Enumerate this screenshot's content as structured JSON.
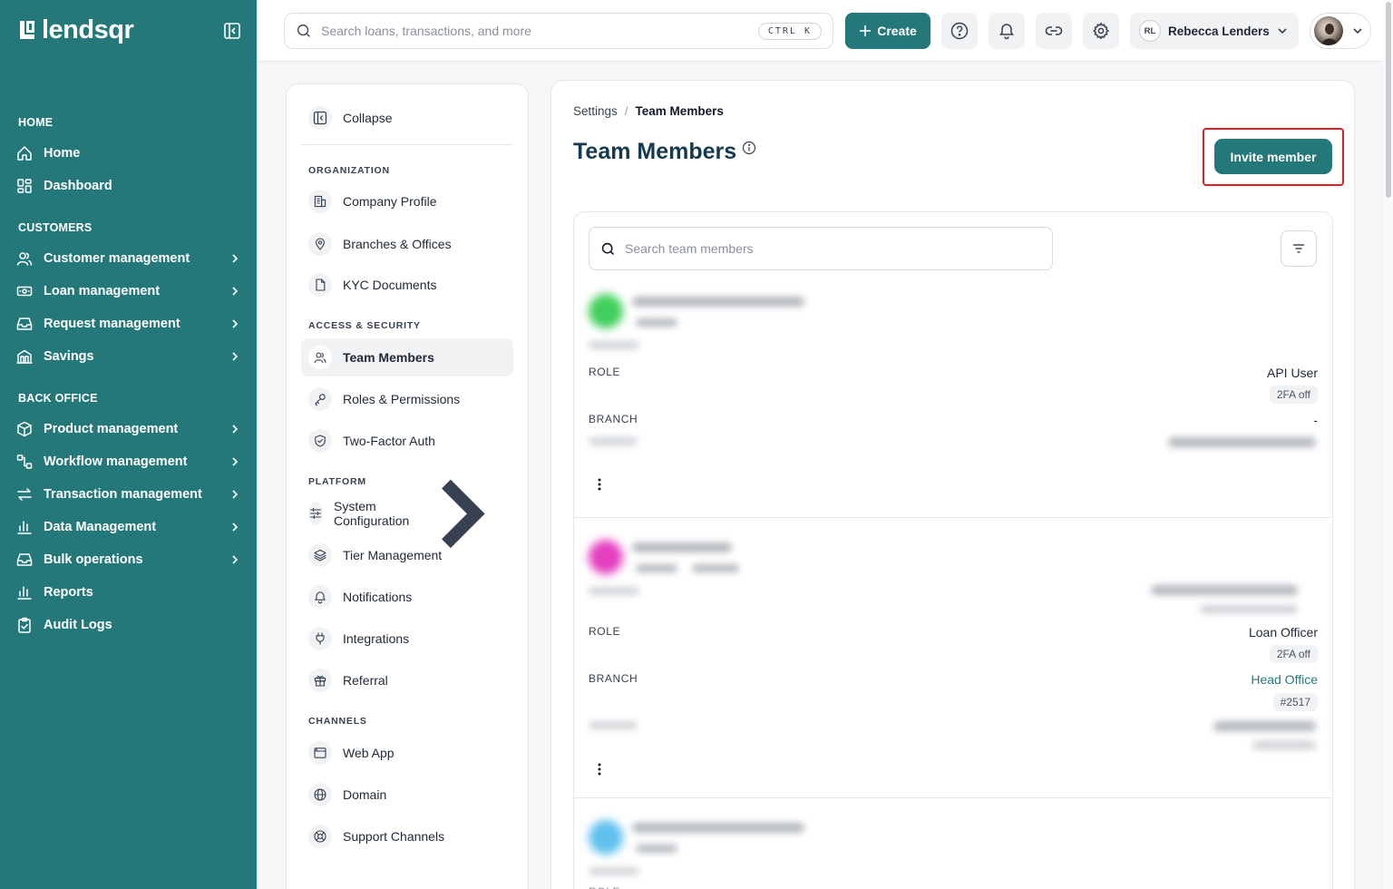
{
  "brand": {
    "name": "lendsqr"
  },
  "colors": {
    "primary": "#24787a",
    "highlight": "#e11d24",
    "title": "#143a4f"
  },
  "sidebar": {
    "sections": [
      {
        "title": "HOME",
        "items": [
          {
            "label": "Home",
            "icon": "home-icon",
            "chevron": false
          },
          {
            "label": "Dashboard",
            "icon": "dashboard-grid-icon",
            "chevron": false
          }
        ]
      },
      {
        "title": "CUSTOMERS",
        "items": [
          {
            "label": "Customer management",
            "icon": "users-icon",
            "chevron": true
          },
          {
            "label": "Loan management",
            "icon": "money-icon",
            "chevron": true
          },
          {
            "label": "Request management",
            "icon": "inbox-icon",
            "chevron": true
          },
          {
            "label": "Savings",
            "icon": "savings-icon",
            "chevron": true
          }
        ]
      },
      {
        "title": "BACK OFFICE",
        "items": [
          {
            "label": "Product management",
            "icon": "box-icon",
            "chevron": true
          },
          {
            "label": "Workflow management",
            "icon": "workflow-icon",
            "chevron": true
          },
          {
            "label": "Transaction management",
            "icon": "transfer-icon",
            "chevron": true
          },
          {
            "label": "Data Management",
            "icon": "bar-chart-icon",
            "chevron": true
          },
          {
            "label": "Bulk operations",
            "icon": "inbox-icon",
            "chevron": true
          },
          {
            "label": "Reports",
            "icon": "bar-chart-icon",
            "chevron": false
          },
          {
            "label": "Audit Logs",
            "icon": "clipboard-check-icon",
            "chevron": false
          }
        ]
      }
    ]
  },
  "topbar": {
    "search_placeholder": "Search loans, transactions, and more",
    "shortcut": "CTRL K",
    "create_label": "Create",
    "user": {
      "initials": "RL",
      "name": "Rebecca Lenders"
    }
  },
  "settings_nav": {
    "collapse_label": "Collapse",
    "sections": [
      {
        "title": "ORGANIZATION",
        "items": [
          {
            "label": "Company Profile",
            "icon": "building-icon"
          },
          {
            "label": "Branches & Offices",
            "icon": "map-pin-icon"
          },
          {
            "label": "KYC Documents",
            "icon": "document-icon"
          }
        ]
      },
      {
        "title": "ACCESS & SECURITY",
        "items": [
          {
            "label": "Team Members",
            "icon": "users-icon",
            "active": true
          },
          {
            "label": "Roles & Permissions",
            "icon": "key-icon"
          },
          {
            "label": "Two-Factor Auth",
            "icon": "shield-icon"
          }
        ]
      },
      {
        "title": "PLATFORM",
        "items": [
          {
            "label": "System Configuration",
            "icon": "sliders-icon",
            "chevron": true
          },
          {
            "label": "Tier Management",
            "icon": "layers-icon"
          },
          {
            "label": "Notifications",
            "icon": "bell-icon"
          },
          {
            "label": "Integrations",
            "icon": "plug-icon"
          },
          {
            "label": "Referral",
            "icon": "gift-icon"
          }
        ]
      },
      {
        "title": "CHANNELS",
        "items": [
          {
            "label": "Web App",
            "icon": "browser-icon"
          },
          {
            "label": "Domain",
            "icon": "globe-icon"
          },
          {
            "label": "Support Channels",
            "icon": "lifebuoy-icon"
          }
        ]
      }
    ]
  },
  "main": {
    "breadcrumb": {
      "parent": "Settings",
      "separator": "/",
      "current": "Team Members"
    },
    "title": "Team Members",
    "invite_label": "Invite member",
    "search_placeholder": "Search team members",
    "members": [
      {
        "avatar_color": "#3fcf5a",
        "role_label": "ROLE",
        "role": "API User",
        "twofa": "2FA off",
        "branch_label": "BRANCH",
        "branch": "-",
        "branch_is_link": false,
        "branch_code": ""
      },
      {
        "avatar_color": "#e43fc0",
        "role_label": "ROLE",
        "role": "Loan Officer",
        "twofa": "2FA off",
        "branch_label": "BRANCH",
        "branch": "Head Office",
        "branch_is_link": true,
        "branch_code": "#2517"
      },
      {
        "avatar_color": "#5fc0ee",
        "role_label": "ROLE"
      }
    ]
  }
}
